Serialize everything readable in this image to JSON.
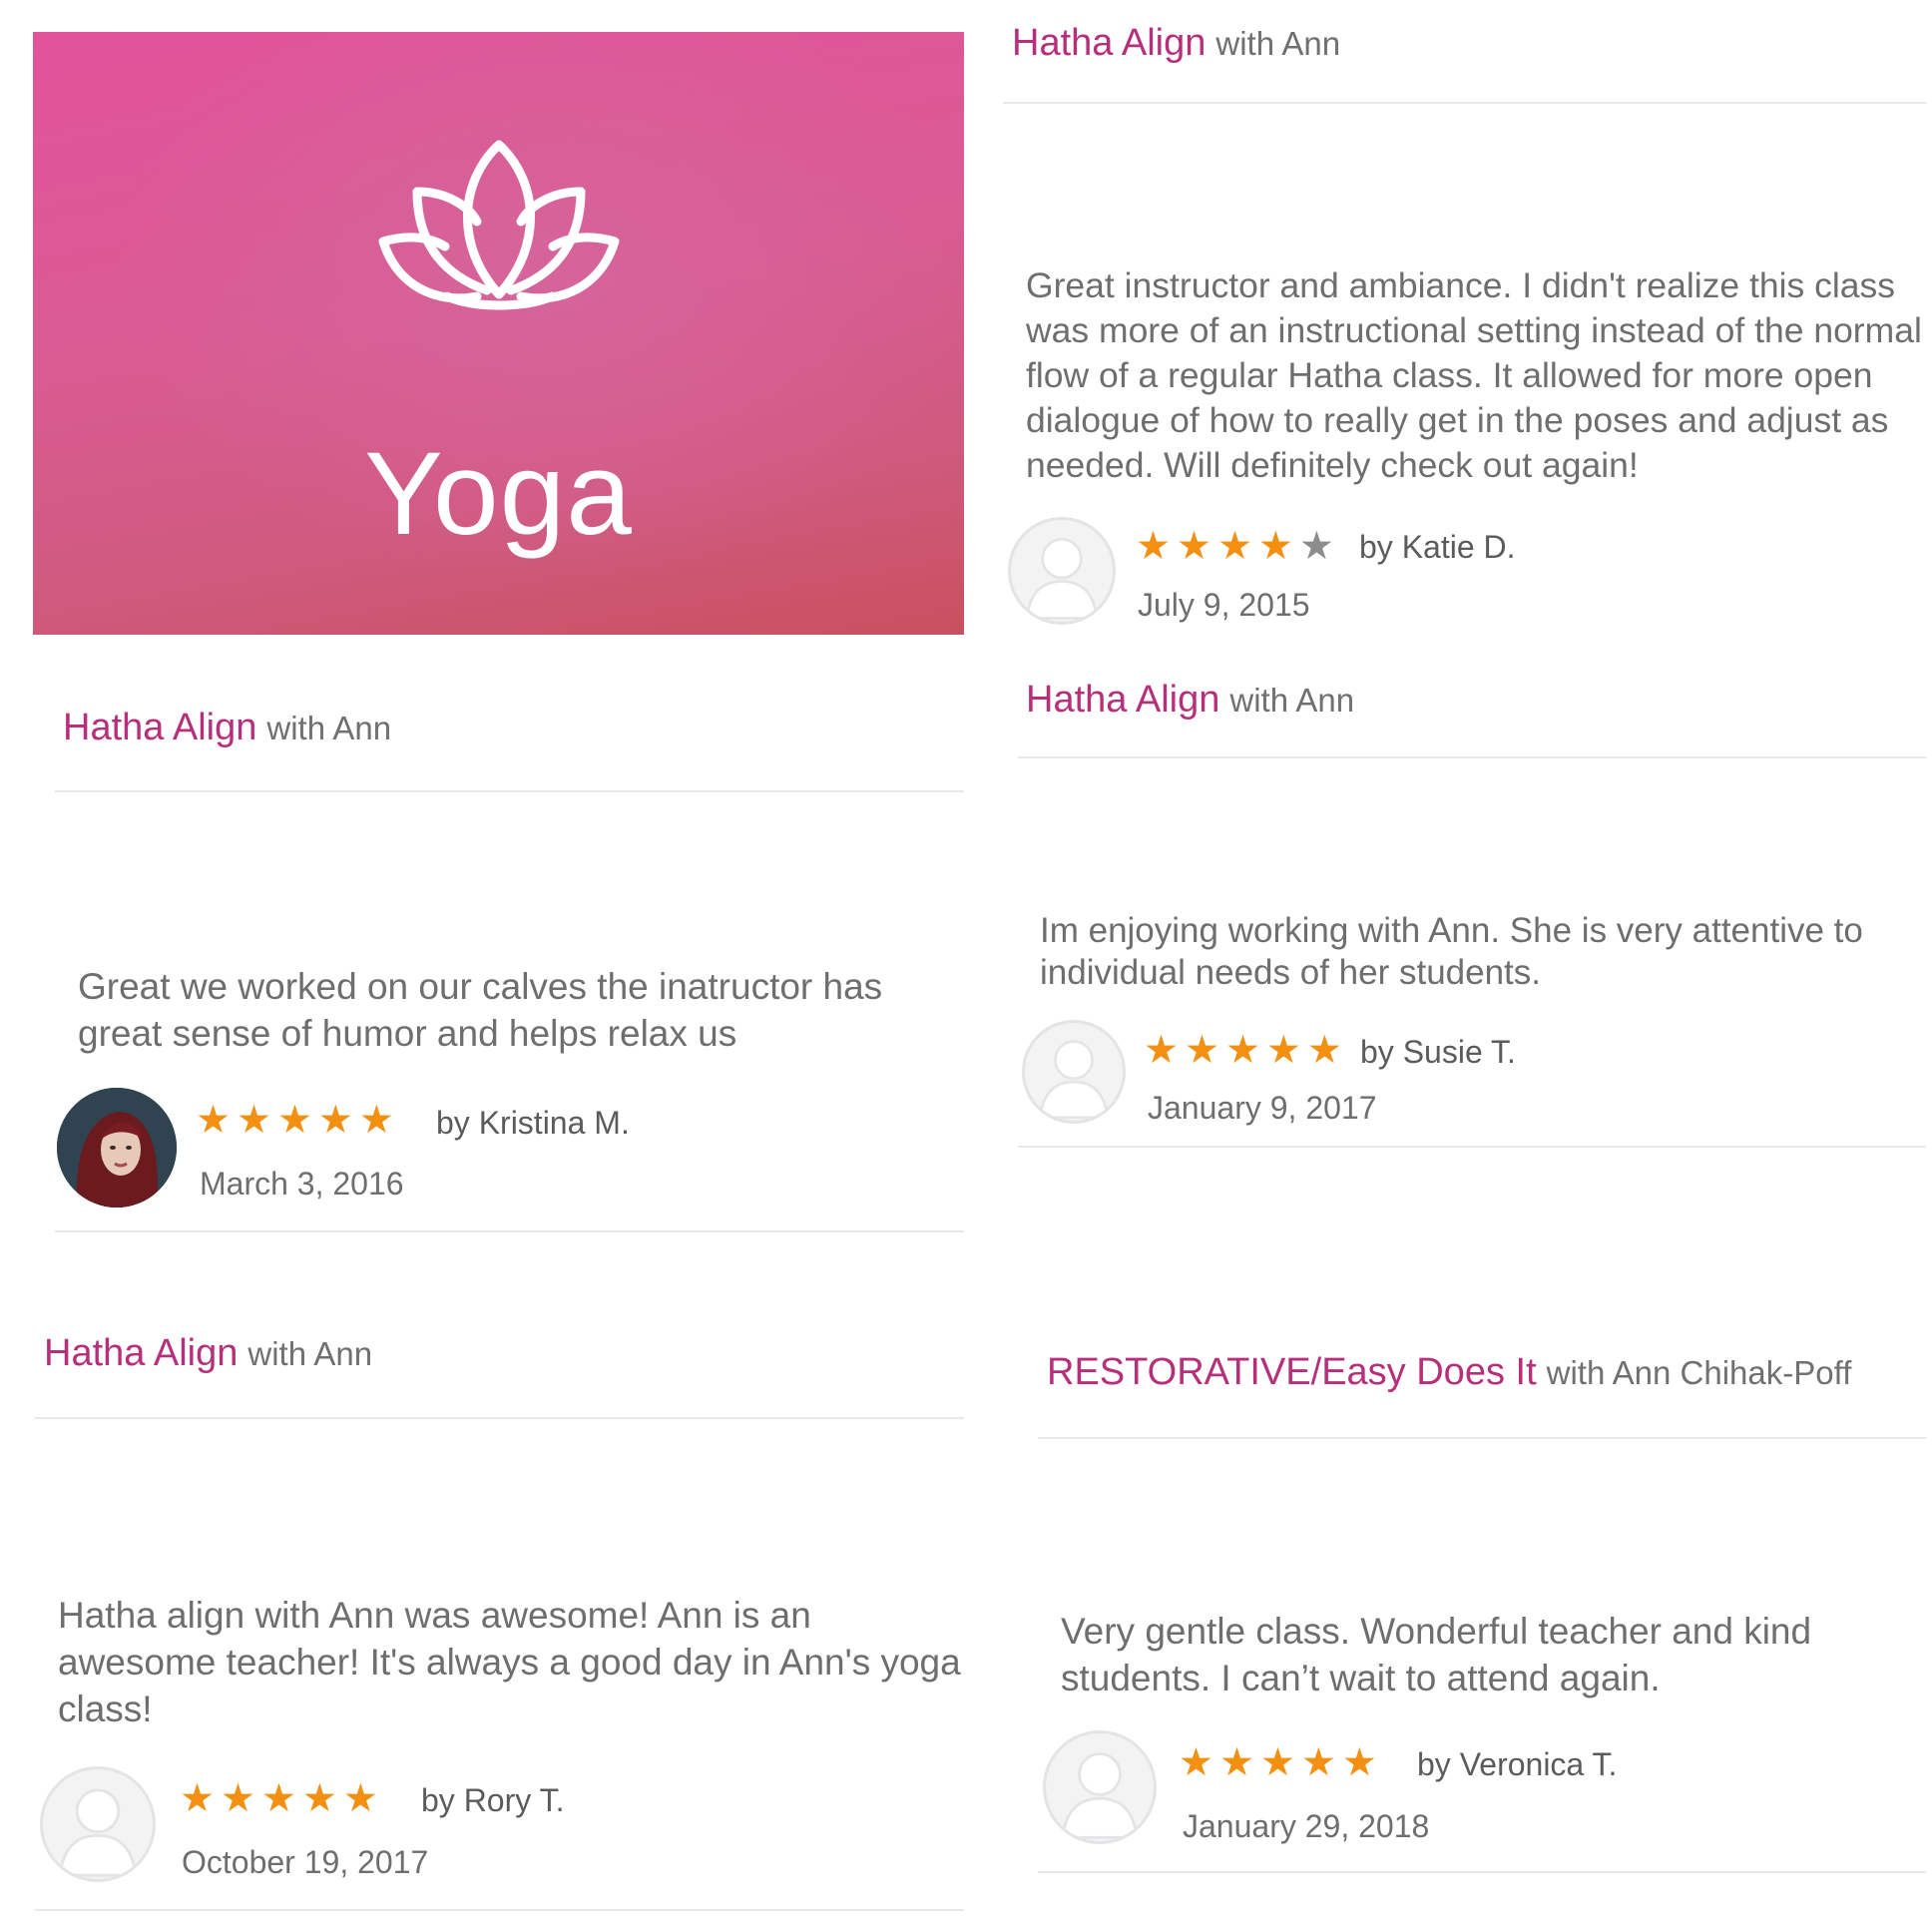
{
  "banner": {
    "label": "Yoga"
  },
  "reviews": [
    {
      "class_name": "Hatha Align",
      "instructor": "with Ann",
      "text": "Great we worked on our calves the inatructor has great sense of humor and helps relax us",
      "rating": 5,
      "reviewer": "by Kristina M.",
      "date": "March 3, 2016"
    },
    {
      "class_name": "Hatha Align",
      "instructor": "with Ann",
      "text": "Hatha align with Ann was awesome!  Ann is an awesome teacher!  It's always a good day in Ann's yoga class!",
      "rating": 5,
      "reviewer": "by Rory T.",
      "date": "October 19, 2017"
    },
    {
      "class_name": "Hatha Align",
      "instructor": "with Ann",
      "text": "Great instructor and ambiance. I didn't realize this class was more of an instructional setting instead of the normal flow of a regular Hatha class. It allowed for more open dialogue of how to really get in the poses and adjust as needed. Will definitely check out again!",
      "rating": 4,
      "reviewer": "by Katie D.",
      "date": "July 9, 2015"
    },
    {
      "class_name": "Hatha Align",
      "instructor": "with Ann",
      "text": "Im enjoying working with Ann. She is very attentive to individual needs of her students.",
      "rating": 5,
      "reviewer": "by Susie T.",
      "date": "January 9, 2017"
    },
    {
      "class_name": "RESTORATIVE/Easy Does It",
      "instructor": "with Ann Chihak-Poff",
      "text": "Very gentle class. Wonderful teacher and kind students. I can’t wait to attend again.",
      "rating": 5,
      "reviewer": "by Veronica T.",
      "date": "January 29, 2018"
    }
  ],
  "colors": {
    "class_title": "#b72f7b",
    "star_filled": "#f39012",
    "star_empty": "#8d8d8d",
    "banner": "#d95b92"
  },
  "icons": [
    "lotus-icon",
    "star-icon",
    "avatar-placeholder-icon",
    "profile-photo"
  ]
}
